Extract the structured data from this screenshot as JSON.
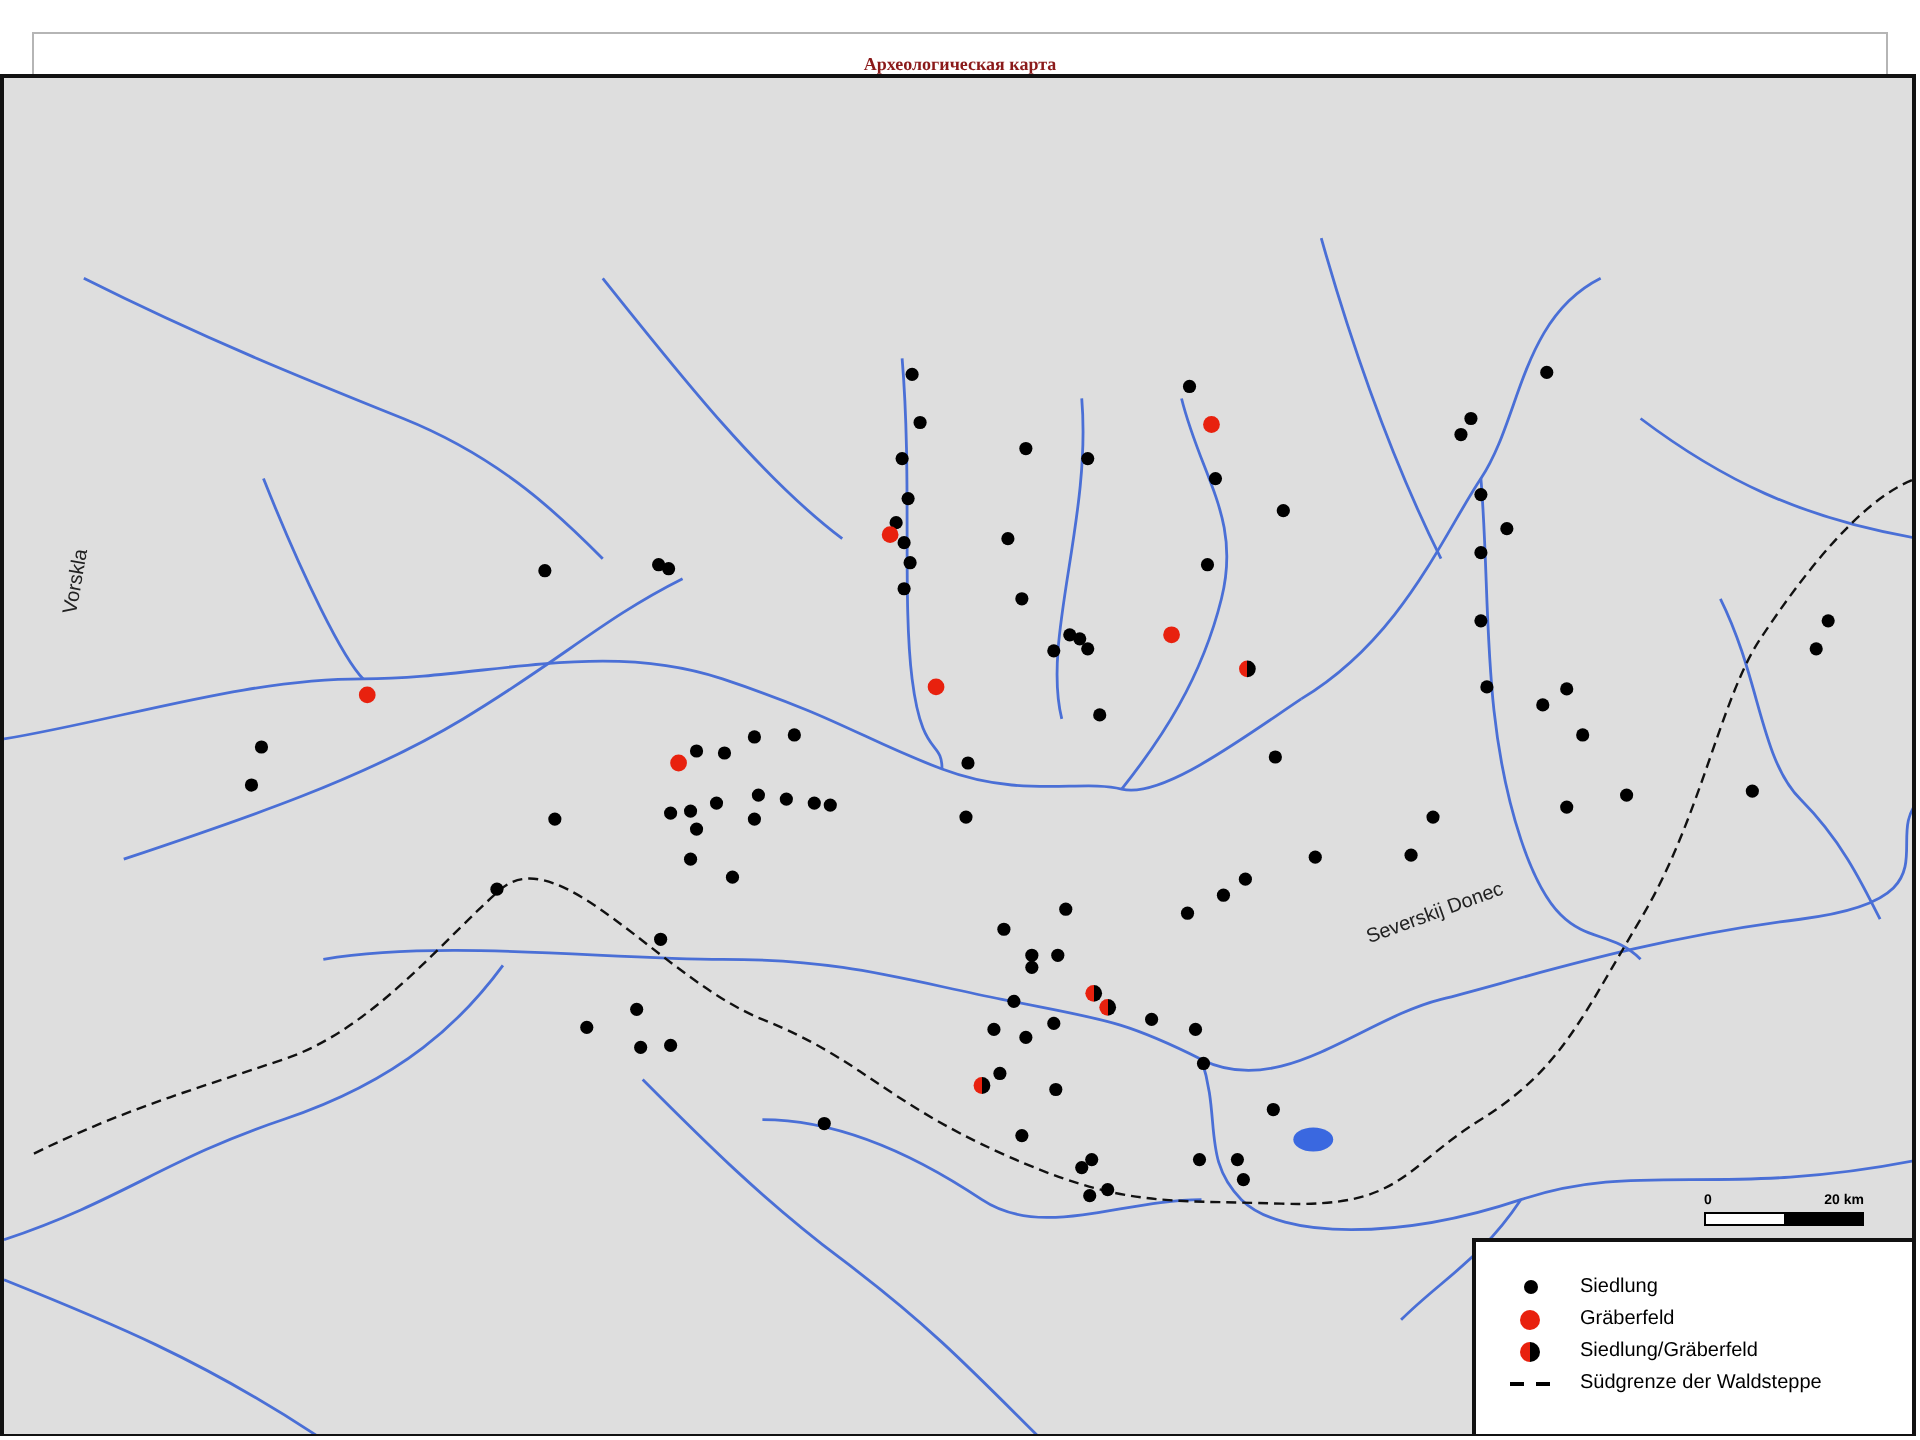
{
  "title": "Археологическая карта",
  "river_labels": [
    {
      "text": "Vorskla",
      "kind": "vertical"
    },
    {
      "text": "Severskij Donec",
      "kind": "slanted"
    }
  ],
  "scale": {
    "start": "0",
    "end": "20 km"
  },
  "legend": [
    {
      "label": "Siedlung",
      "kind": "dot",
      "color": "#000000"
    },
    {
      "label": "Gräberfeld",
      "kind": "dot",
      "color": "#e8210e"
    },
    {
      "label": "Siedlung/Gräberfeld",
      "kind": "half-dot",
      "color": "#e8210e"
    },
    {
      "label": "Südgrenze der Waldsteppe",
      "kind": "dashed-line"
    }
  ]
}
